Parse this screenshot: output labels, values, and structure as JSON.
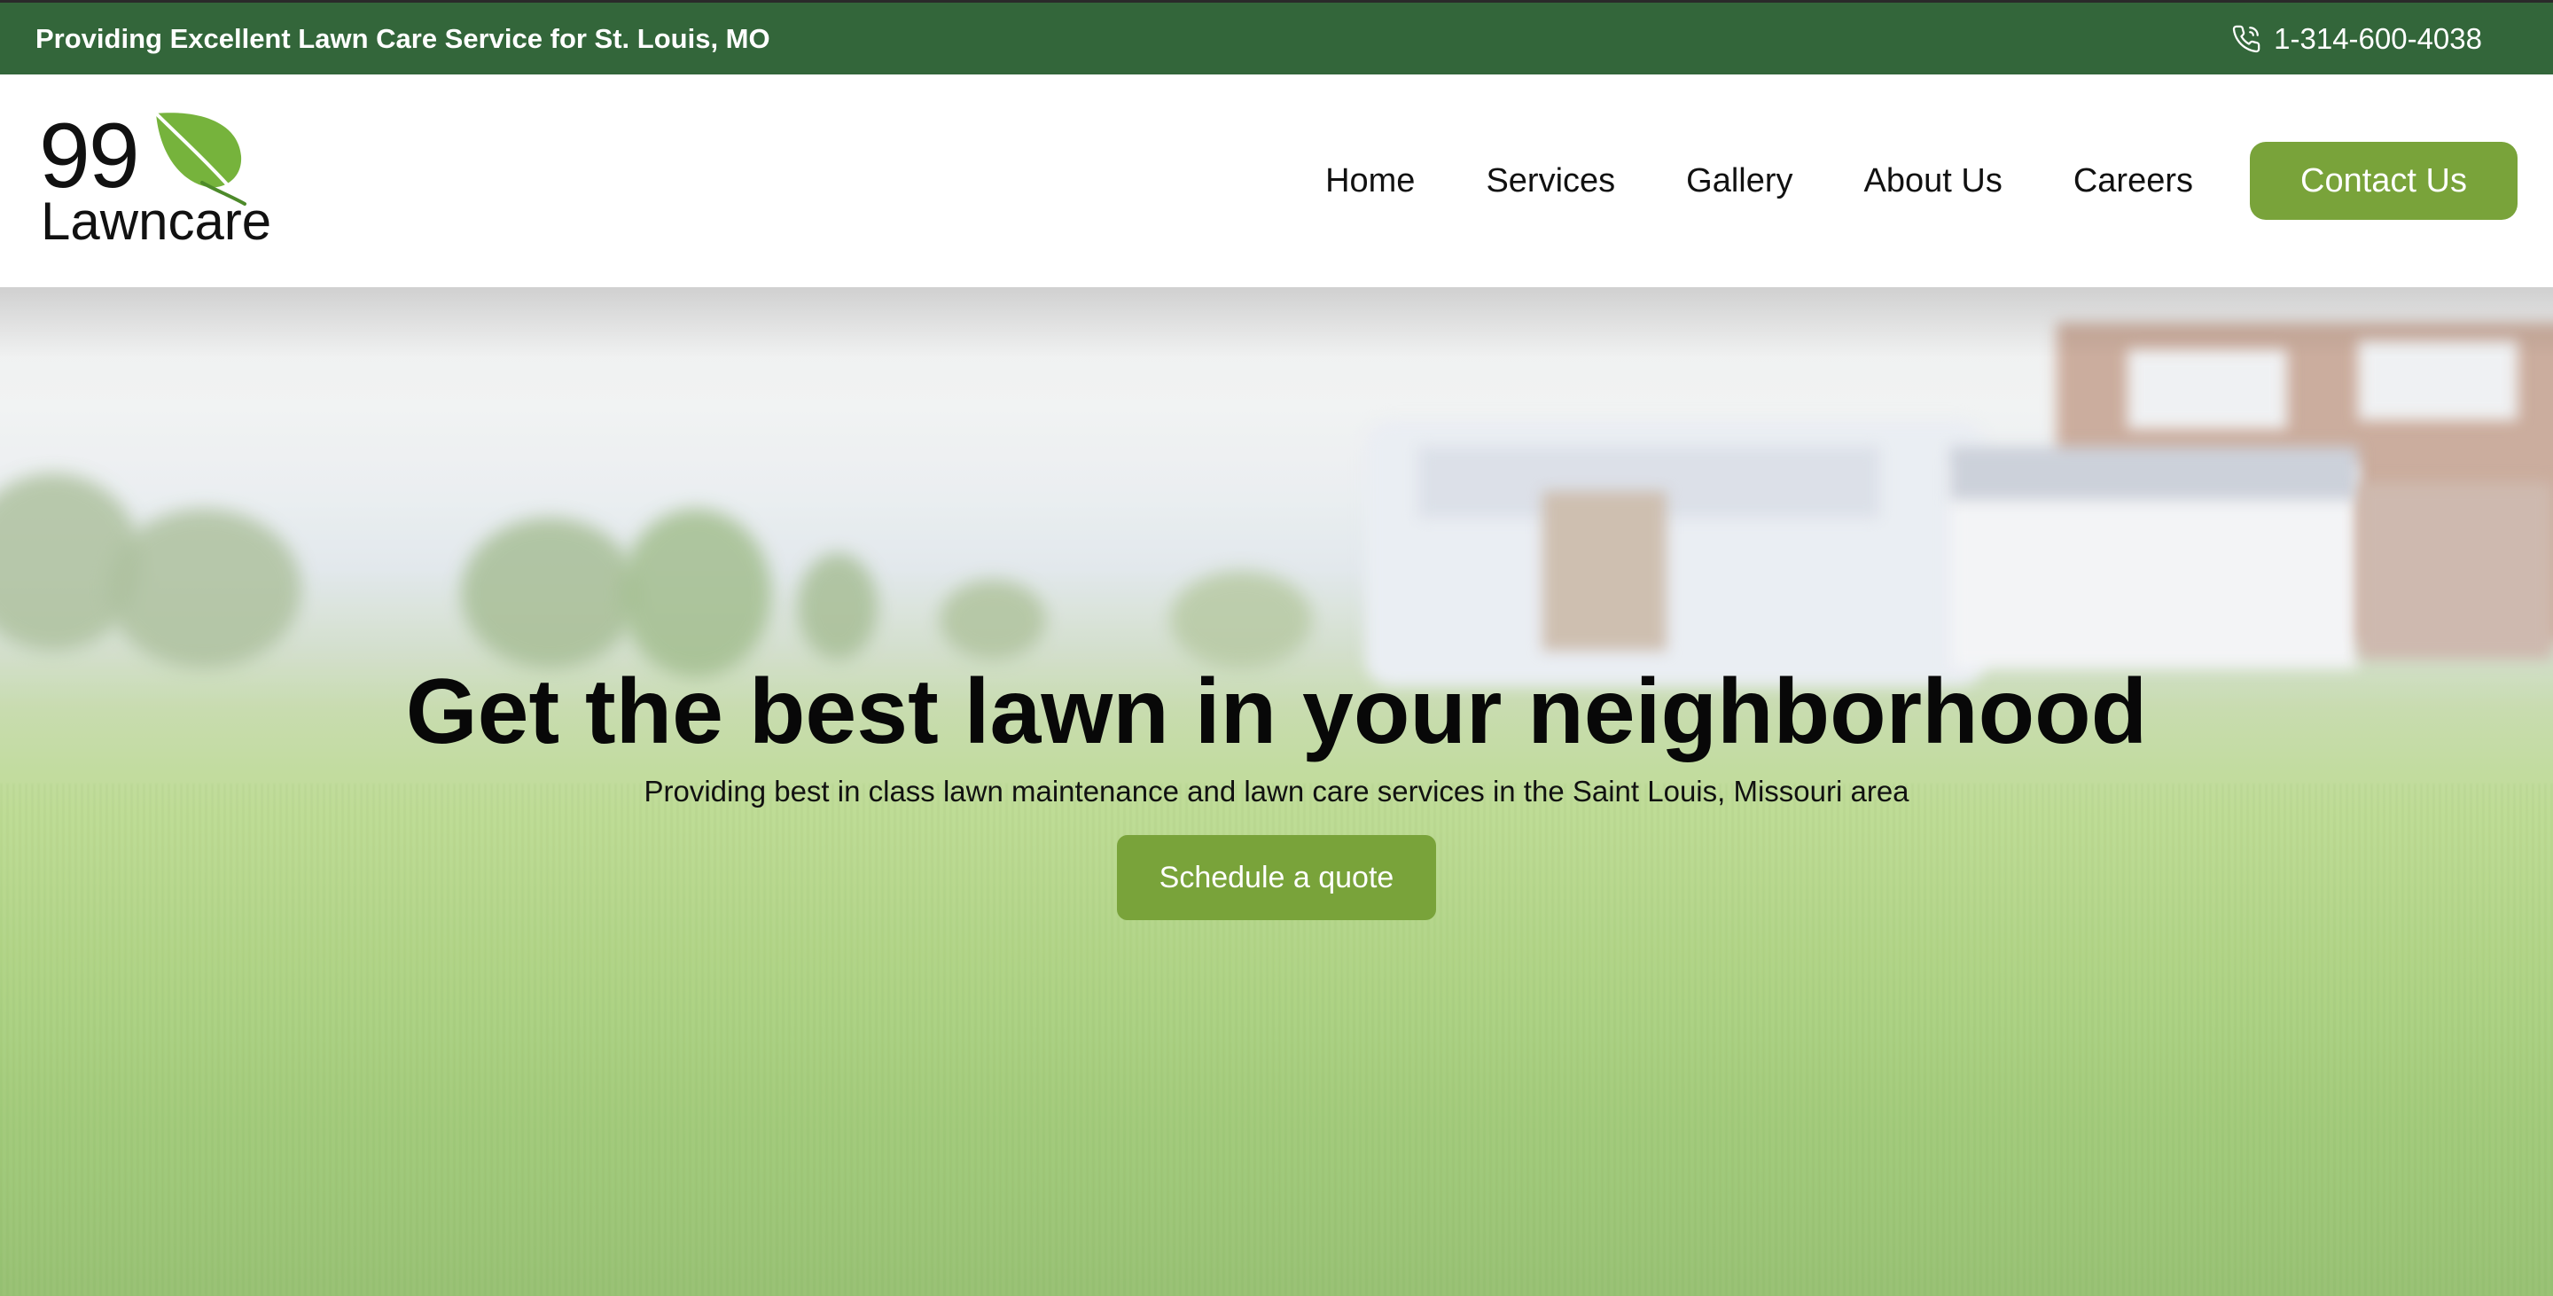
{
  "topbar": {
    "tagline": "Providing Excellent Lawn Care Service for St. Louis, MO",
    "phone": "1-314-600-4038",
    "phone_icon": "phone-icon"
  },
  "logo": {
    "number": "99",
    "word": "Lawncare",
    "leaf_icon": "leaf-icon"
  },
  "nav": {
    "items": [
      "Home",
      "Services",
      "Gallery",
      "About Us",
      "Careers"
    ],
    "contact": "Contact Us"
  },
  "hero": {
    "title": "Get the best lawn in your neighborhood",
    "subtitle": "Providing best in class lawn maintenance and lawn care services in the Saint Louis, Missouri area",
    "cta": "Schedule a quote"
  },
  "colors": {
    "topbar": "#33663a",
    "accent": "#79a33a",
    "text": "#111111"
  }
}
